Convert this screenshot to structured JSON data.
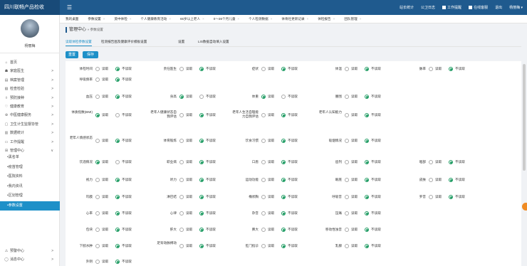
{
  "topbar": {
    "app_title": "四川联畅产品检收",
    "nav": [
      "站长统计",
      "公卫日志",
      "工作提醒",
      "在线客服",
      "退出",
      "杨丽梅 ▾"
    ]
  },
  "sidebar": {
    "username": "杨丽梅",
    "items": [
      {
        "icon": "home-icon",
        "glyph": "⌂",
        "label": "首页",
        "chevron": ""
      },
      {
        "icon": "user-icon",
        "glyph": "☗",
        "label": "家庭医生",
        "chevron": ">"
      },
      {
        "icon": "file-icon",
        "glyph": "▤",
        "label": "档案管理",
        "chevron": ">"
      },
      {
        "icon": "check-icon",
        "glyph": "▧",
        "label": "检查检验",
        "chevron": ">"
      },
      {
        "icon": "vaccine-icon",
        "glyph": "◊",
        "label": "预防接种",
        "chevron": ">"
      },
      {
        "icon": "heart-icon",
        "glyph": "♡",
        "label": "健康教育",
        "chevron": ">"
      },
      {
        "icon": "medicine-icon",
        "glyph": "⊕",
        "label": "中医健康服务",
        "chevron": ">"
      },
      {
        "icon": "shield-icon",
        "glyph": "▢",
        "label": "卫生计生监督协管",
        "chevron": ">"
      },
      {
        "icon": "chart-icon",
        "glyph": "▥",
        "label": "数据统计",
        "chevron": ">"
      },
      {
        "icon": "bell-icon",
        "glyph": "▭",
        "label": "工作提醒",
        "chevron": ">"
      },
      {
        "icon": "grid-icon",
        "glyph": "⊞",
        "label": "管理中心",
        "chevron": "∨"
      }
    ],
    "sub_items": [
      "•黑名单",
      "•疫苗管理",
      "•医院资料",
      "•我内资讯",
      "•区划管理",
      "•参数设置"
    ],
    "bottom_items": [
      {
        "icon": "alert-icon",
        "glyph": "⚠",
        "label": "预警中心",
        "chevron": ">"
      },
      {
        "icon": "message-icon",
        "glyph": "◯",
        "label": "消息中心",
        "chevron": ">"
      }
    ]
  },
  "tabs": [
    "我的桌面",
    "参数设置",
    "莫中体检",
    "个人健康教育活动",
    "65岁以上老人",
    "0～36个月儿童",
    "个人检测数据",
    "体骨社更新记录",
    "体检报告",
    "团队管理"
  ],
  "breadcrumb": {
    "title": "管理中心",
    "sub": "» 参数设置"
  },
  "subtabs": [
    "读取体检参数设置",
    "检测报告图及健康评价模板设置",
    "设置",
    "LIS数据自动填入设置"
  ],
  "buttons": {
    "reset": "重置",
    "save": "保存"
  },
  "options": {
    "read": "读取",
    "noread": "不读取"
  },
  "fields": [
    {
      "label": "体检时间",
      "value": "noread"
    },
    {
      "label": "责任医生",
      "value": "noread"
    },
    {
      "label": "症状",
      "value": "noread"
    },
    {
      "label": "体温",
      "value": "noread"
    },
    {
      "label": "脉率",
      "value": "noread"
    },
    {
      "label": "呼吸频率",
      "value": "noread"
    },
    {
      "label": "血压",
      "value": "noread"
    },
    {
      "label": "身高",
      "value": "read"
    },
    {
      "label": "体重",
      "value": "read"
    },
    {
      "label": "腰围",
      "value": "noread"
    },
    {
      "label": "体质指数(BMI)",
      "value": "read"
    },
    {
      "label": "老年人健康状态自我评估",
      "value": "noread"
    },
    {
      "label": "老年人生活自理能力自我评估",
      "value": "noread"
    },
    {
      "label": "老年人认知能力",
      "value": "noread"
    },
    {
      "label": "老年人情感状态",
      "value": "noread"
    },
    {
      "label": "体育锻炼",
      "value": "noread"
    },
    {
      "label": "饮食习惯",
      "value": "noread"
    },
    {
      "label": "吸烟情况",
      "value": "noread"
    },
    {
      "label": "饮酒情况",
      "value": "read"
    },
    {
      "label": "职业病",
      "value": "noread"
    },
    {
      "label": "口唇",
      "value": "noread"
    },
    {
      "label": "齿列",
      "value": "noread"
    },
    {
      "label": "咽部",
      "value": "noread"
    },
    {
      "label": "视力",
      "value": "noread"
    },
    {
      "label": "听力",
      "value": "noread"
    },
    {
      "label": "运动功能",
      "value": "noread"
    },
    {
      "label": "眼底",
      "value": "noread"
    },
    {
      "label": "皮肤",
      "value": "noread"
    },
    {
      "label": "巩膜",
      "value": "noread"
    },
    {
      "label": "淋巴结",
      "value": "noread"
    },
    {
      "label": "桶状胸",
      "value": "noread"
    },
    {
      "label": "呼吸音",
      "value": "noread"
    },
    {
      "label": "罗音",
      "value": "noread"
    },
    {
      "label": "心率",
      "value": "noread"
    },
    {
      "label": "心律",
      "value": "noread"
    },
    {
      "label": "杂音",
      "value": "noread"
    },
    {
      "label": "压痛",
      "value": "noread"
    },
    {
      "label": "包块",
      "value": "noread"
    },
    {
      "label": "肝大",
      "value": "noread"
    },
    {
      "label": "脾大",
      "value": "noread"
    },
    {
      "label": "移动性浊音",
      "value": "noread"
    },
    {
      "label": "下肢水肿",
      "value": "noread"
    },
    {
      "label": "足背动脉搏动",
      "value": "noread"
    },
    {
      "label": "肛门指诊",
      "value": "noread"
    },
    {
      "label": "乳腺",
      "value": "noread"
    },
    {
      "label": "外阴",
      "value": "noread"
    }
  ],
  "colors": {
    "topbar": "#1f5a8e",
    "accent": "#1e90c8",
    "radio_checked": "#1e9b62"
  }
}
